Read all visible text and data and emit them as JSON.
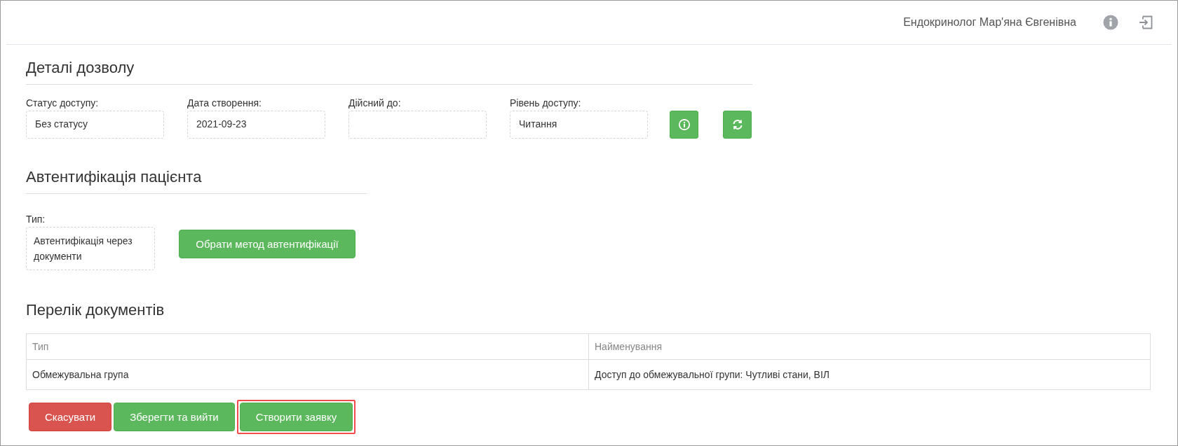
{
  "header": {
    "user_name": "Ендокринолог Мар'яна Євгенівна"
  },
  "permission_details": {
    "title": "Деталі дозволу",
    "fields": [
      {
        "label": "Статус доступу:",
        "value": "Без статусу"
      },
      {
        "label": "Дата створення:",
        "value": "2021-09-23"
      },
      {
        "label": "Дійсний до:"
      },
      {
        "label": "Рівень доступу:",
        "value": "Читання"
      }
    ]
  },
  "patient_auth": {
    "title": "Автентифікація пацієнта",
    "type_label": "Тип:",
    "type_value": "Автентифікація через документи",
    "button": "Обрати метод автентифікації"
  },
  "documents": {
    "title": "Перелік документів",
    "columns": [
      "Тип",
      "Найменування"
    ],
    "rows": [
      [
        "Обмежувальна група",
        "Доступ до обмежувальної групи: Чутливі стани, ВІЛ"
      ]
    ]
  },
  "actions": [
    {
      "label": "Скасувати",
      "kind": "danger",
      "highlighted": false
    },
    {
      "label": "Зберегти та вийти",
      "kind": "success",
      "highlighted": false
    },
    {
      "label": "Створити заявку",
      "kind": "success",
      "highlighted": true
    }
  ]
}
